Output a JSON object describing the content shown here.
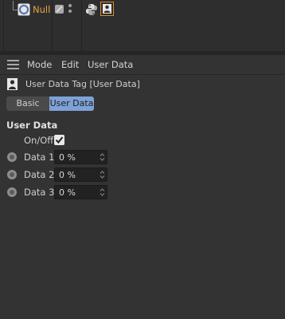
{
  "object_manager": {
    "objects": [
      {
        "name": "Null",
        "color": "#e8a23c"
      }
    ],
    "tags": [
      "python-tag-icon",
      "user-data-tag-icon"
    ]
  },
  "menubar": {
    "icon": "hamburger-menu-icon",
    "items": [
      "Mode",
      "Edit",
      "User Data"
    ]
  },
  "attributes": {
    "title": "User Data Tag [User Data]",
    "tabs": [
      {
        "label": "Basic",
        "active": false
      },
      {
        "label": "User Data",
        "active": true
      }
    ],
    "group_title": "User Data",
    "on_off": {
      "label": "On/Off",
      "checked": true
    },
    "fields": [
      {
        "label": "Data 1",
        "value": "0 %"
      },
      {
        "label": "Data 2",
        "value": "0 %"
      },
      {
        "label": "Data 3",
        "value": "0 %"
      }
    ]
  },
  "colors": {
    "accent": "#7ea2d6",
    "selected_tag_border": "#e08a2a",
    "object_name": "#e8a23c"
  }
}
